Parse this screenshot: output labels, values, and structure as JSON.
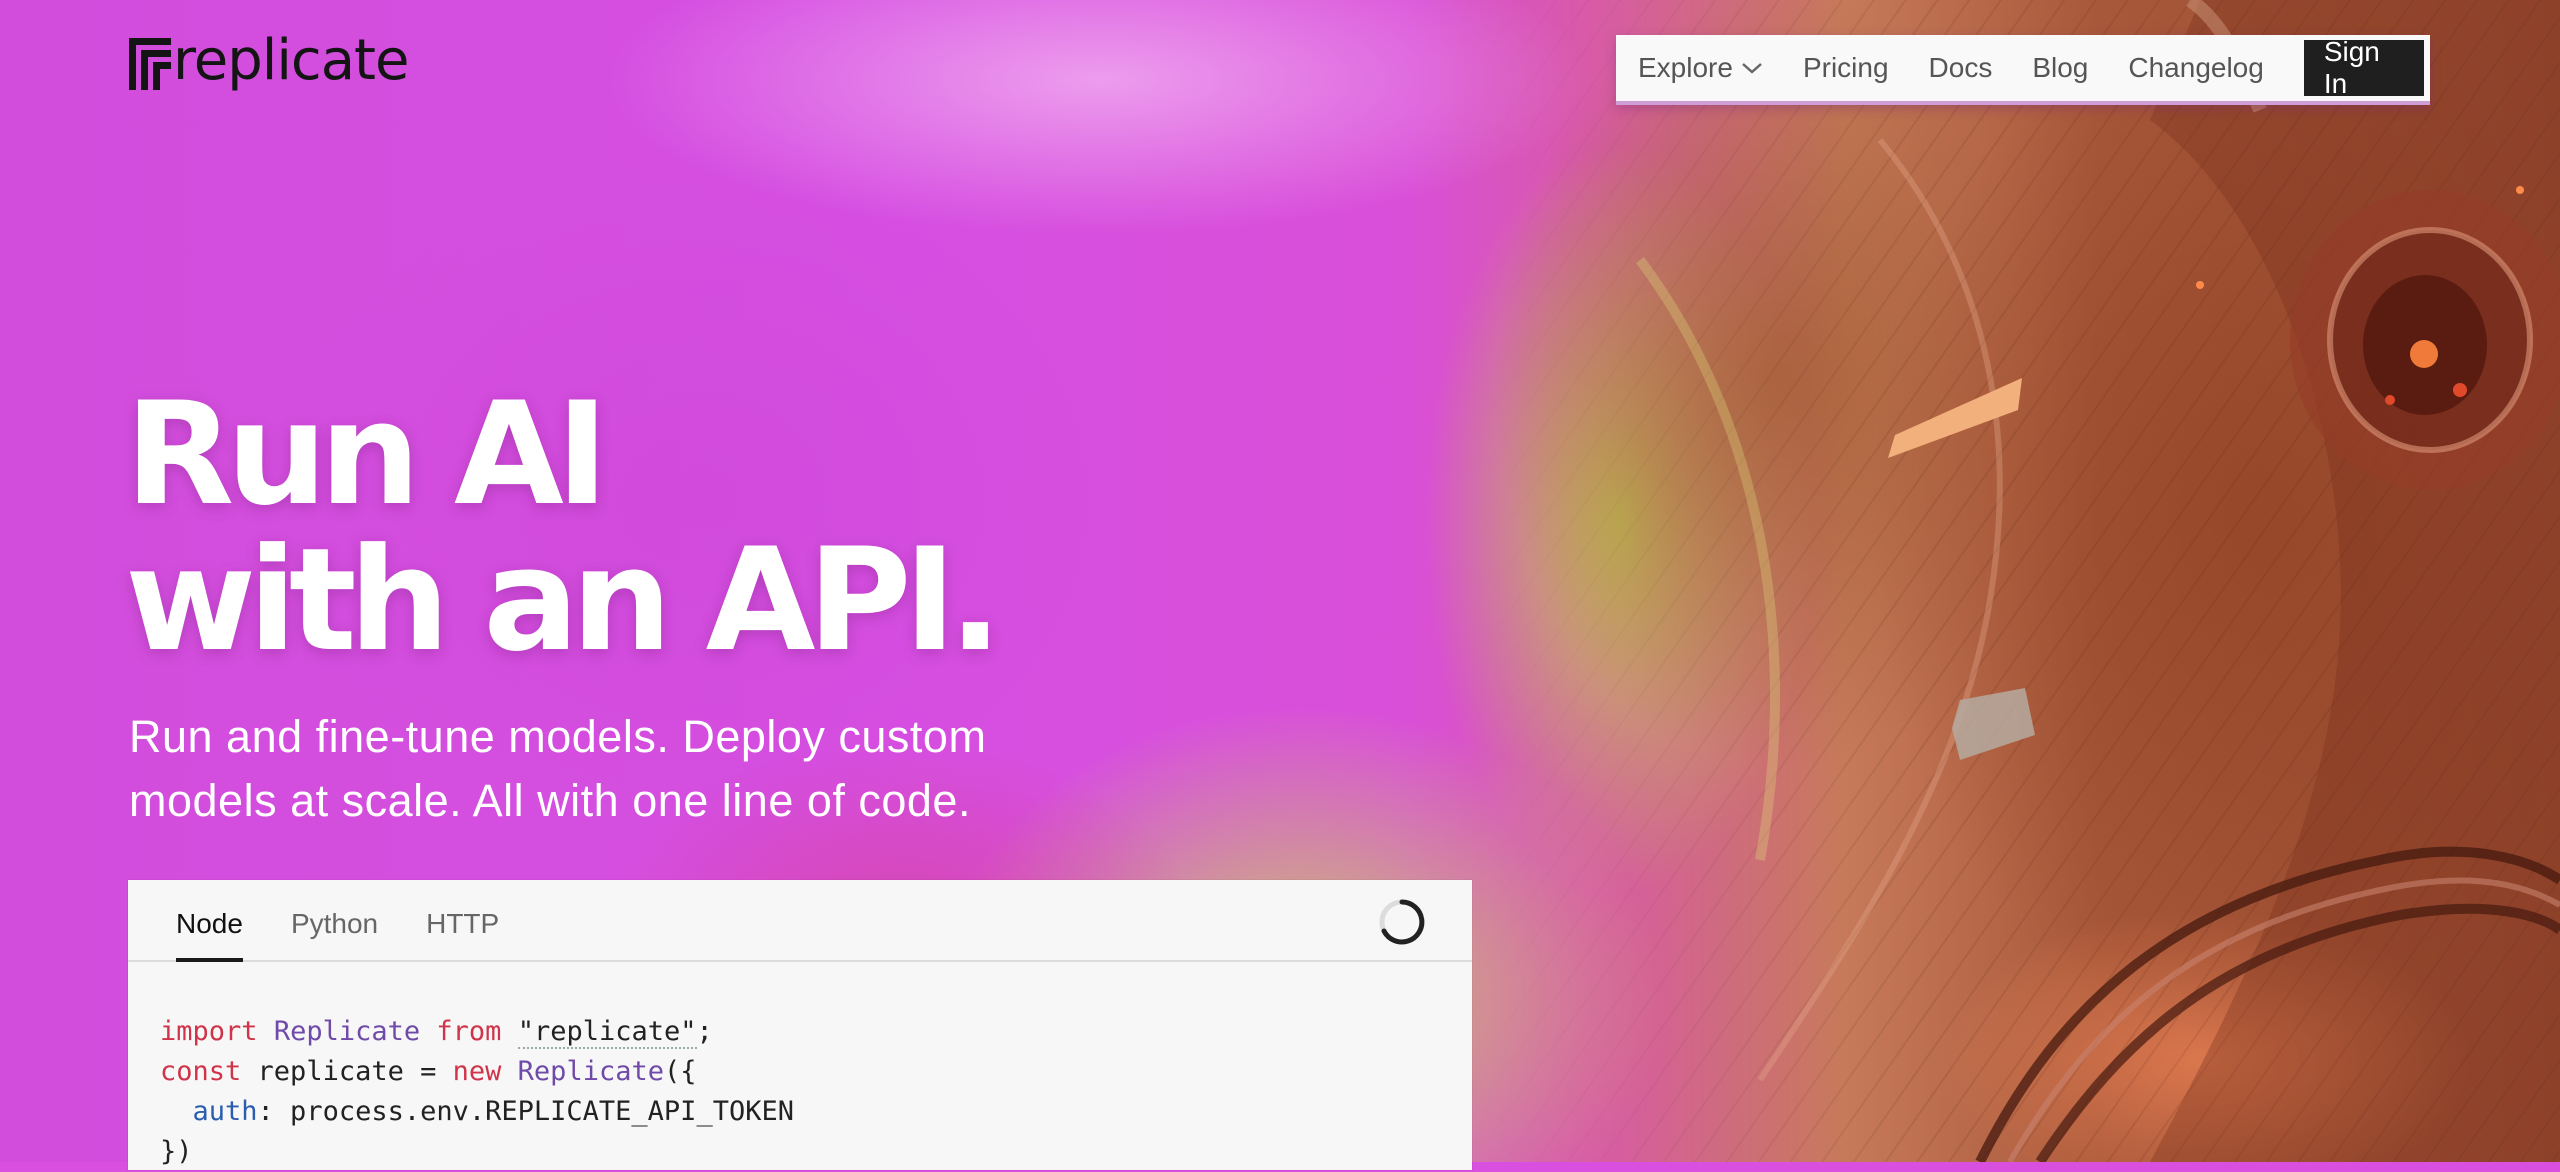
{
  "brand": {
    "name": "replicate"
  },
  "nav": {
    "items": [
      {
        "label": "Explore",
        "has_dropdown": true
      },
      {
        "label": "Pricing"
      },
      {
        "label": "Docs"
      },
      {
        "label": "Blog"
      },
      {
        "label": "Changelog"
      }
    ],
    "signin_label": "Sign In"
  },
  "hero": {
    "title_line1": "Run AI",
    "title_line2": "with an API.",
    "subtitle": "Run and fine-tune models. Deploy custom models at scale. All with one line of code."
  },
  "code_panel": {
    "tabs": [
      {
        "label": "Node",
        "active": true
      },
      {
        "label": "Python",
        "active": false
      },
      {
        "label": "HTTP",
        "active": false
      }
    ],
    "lines": {
      "l1": {
        "kw1": "import",
        "cls": "Replicate",
        "kw2": "from",
        "str": "\"replicate\"",
        "end": ";"
      },
      "l2": {
        "kw": "const",
        "plain": "replicate =",
        "kw_new": "new",
        "cls": "Replicate",
        "end": "({"
      },
      "l3": {
        "prop": "auth",
        "rest": ": process.env.REPLICATE_API_TOKEN"
      },
      "l4": {
        "text": "})"
      }
    }
  },
  "colors": {
    "hero_text": "#ffffff",
    "keyword": "#d0344a",
    "class_name": "#6f4aa8",
    "property": "#2a5db0",
    "signin_bg": "#1f1f1f"
  },
  "icons": [
    "replicate-logo-icon",
    "chevron-down-icon",
    "loading-spinner-icon"
  ]
}
